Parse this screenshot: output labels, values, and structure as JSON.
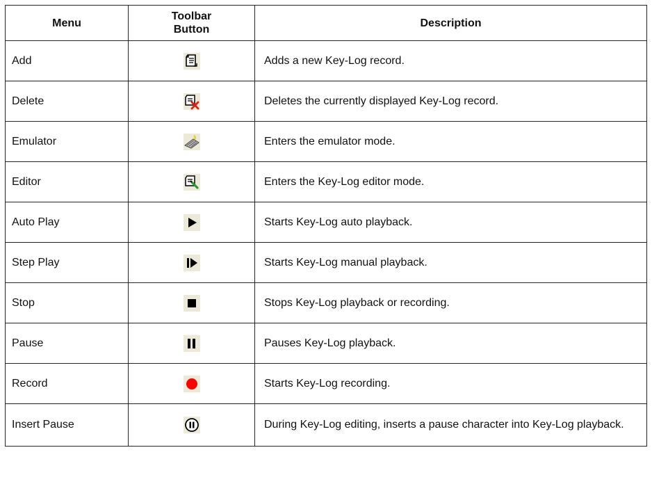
{
  "headers": {
    "menu": "Menu",
    "toolbar_line1": "Toolbar",
    "toolbar_line2": "Button",
    "description": "Description"
  },
  "rows": [
    {
      "menu": "Add",
      "icon": "add-record-icon",
      "description": "Adds a new Key-Log record."
    },
    {
      "menu": "Delete",
      "icon": "delete-record-icon",
      "description": "Deletes the currently displayed Key-Log record."
    },
    {
      "menu": "Emulator",
      "icon": "keyboard-emulator-icon",
      "description": "Enters the emulator mode."
    },
    {
      "menu": "Editor",
      "icon": "editor-pencil-icon",
      "description": "Enters the Key-Log editor mode."
    },
    {
      "menu": "Auto Play",
      "icon": "play-icon",
      "description": "Starts Key-Log auto playback."
    },
    {
      "menu": "Step Play",
      "icon": "step-play-icon",
      "description": "Starts Key-Log manual playback."
    },
    {
      "menu": "Stop",
      "icon": "stop-icon",
      "description": "Stops Key-Log playback or recording."
    },
    {
      "menu": "Pause",
      "icon": "pause-icon",
      "description": "Pauses Key-Log playback."
    },
    {
      "menu": "Record",
      "icon": "record-icon",
      "description": "Starts Key-Log recording."
    },
    {
      "menu": "Insert Pause",
      "icon": "insert-pause-icon",
      "description": "During Key-Log editing, inserts a pause character into Key-Log playback."
    }
  ],
  "colors": {
    "icon_background": "#ece9d8",
    "record_red": "#ff0000",
    "delete_red": "#dd2211",
    "keyboard_yellow": "#e8d000",
    "pencil_green": "#2e9a2e"
  }
}
